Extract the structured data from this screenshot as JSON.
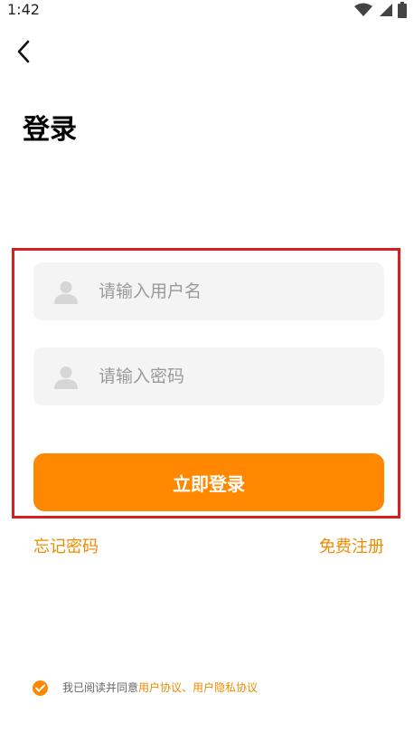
{
  "status_bar": {
    "time": "1:42"
  },
  "page": {
    "title": "登录"
  },
  "form": {
    "username_placeholder": "请输入用户名",
    "password_placeholder": "请输入密码",
    "submit_label": "立即登录"
  },
  "links": {
    "forgot_password": "忘记密码",
    "register": "免费注册"
  },
  "agreement": {
    "prefix": "我已阅读并同意 ",
    "user_agreement": "用户协议",
    "separator": "、",
    "privacy_agreement": "用户隐私协议",
    "checked": true
  },
  "colors": {
    "accent": "#ff8800",
    "link": "#f08a00",
    "input_bg": "#f4f4f4",
    "highlight_border": "#d62020"
  },
  "icons": {
    "back": "chevron-left-icon",
    "username": "user-icon",
    "password": "user-icon",
    "wifi": "wifi-icon",
    "signal": "signal-icon",
    "battery": "battery-icon",
    "check": "check-icon"
  }
}
